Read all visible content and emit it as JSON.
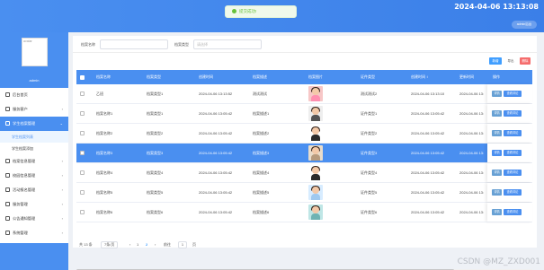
{
  "header": {
    "clock": "2024-04-06 13:13:08",
    "user_button": "admin后台",
    "toast": "提交成功!"
  },
  "sidebar": {
    "avatar_alt": "avatar",
    "admin_name": "admin",
    "items": [
      {
        "label": "后台首页",
        "icon": "home-icon"
      },
      {
        "label": "服务客户",
        "icon": "user-icon",
        "arrow": "›"
      },
      {
        "label": "学生档案管理",
        "icon": "folder-icon",
        "arrow": "⌄",
        "active": true
      },
      {
        "label": "学生档案列表",
        "sub": true,
        "current": true
      },
      {
        "label": "学生档案添加",
        "sub": true
      },
      {
        "label": "档案信息管理",
        "icon": "tag-icon",
        "arrow": "›"
      },
      {
        "label": "校园信息管理",
        "icon": "gear-icon",
        "arrow": "›"
      },
      {
        "label": "活动报名管理",
        "icon": "calendar-icon",
        "arrow": "›"
      },
      {
        "label": "服务管理",
        "icon": "box-icon",
        "arrow": "›"
      },
      {
        "label": "公告通知管理",
        "icon": "bell-icon",
        "arrow": "›"
      },
      {
        "label": "系统管理",
        "icon": "cog-icon",
        "arrow": "›"
      }
    ]
  },
  "search": {
    "label1": "档案名称",
    "input1": "",
    "label2": "档案类型",
    "select_placeholder": "请选择"
  },
  "actions": {
    "add": "新增",
    "export": "导出",
    "delete": "删除"
  },
  "table": {
    "headers": [
      "档案名称",
      "档案类型",
      "创建时间",
      "档案描述",
      "档案图片",
      "证件类型",
      "创建时间 ↕",
      "更新时间",
      "操作"
    ],
    "rows": [
      {
        "name": "乙班",
        "type": "档案类型1",
        "time": "2024-04-06 13:13:52",
        "desc": "测试测试",
        "thumb": "pink",
        "cert": "测试测试2",
        "created": "2024-04-06 13:13:10",
        "updated": "2024-04-06 13:",
        "sel": false
      },
      {
        "name": "档案名称1",
        "type": "档案类型1",
        "time": "2024-04-06 13:05:42",
        "desc": "档案描述1",
        "thumb": "gray",
        "cert": "证件类型1",
        "created": "2024-04-06 13:05:42",
        "updated": "2024-04-06 13:",
        "sel": false
      },
      {
        "name": "档案名称2",
        "type": "档案类型2",
        "time": "2024-04-06 13:05:42",
        "desc": "档案描述2",
        "thumb": "white",
        "cert": "证件类型2",
        "created": "2024-04-06 13:05:42",
        "updated": "2024-04-06 13:",
        "sel": false
      },
      {
        "name": "档案名称3",
        "type": "档案类型3",
        "time": "2024-04-06 13:05:42",
        "desc": "档案描述3",
        "thumb": "tan",
        "cert": "证件类型3",
        "created": "2024-04-06 13:05:42",
        "updated": "2024-04-06 13:",
        "sel": true
      },
      {
        "name": "档案名称4",
        "type": "档案类型4",
        "time": "2024-04-06 13:05:42",
        "desc": "档案描述4",
        "thumb": "white",
        "cert": "证件类型4",
        "created": "2024-04-06 13:05:42",
        "updated": "2024-04-06 13:",
        "sel": false
      },
      {
        "name": "档案名称5",
        "type": "档案类型5",
        "time": "2024-04-06 13:05:42",
        "desc": "档案描述5",
        "thumb": "sky",
        "cert": "证件类型5",
        "created": "2024-04-06 13:05:42",
        "updated": "2024-04-06 13:",
        "sel": false
      },
      {
        "name": "档案名称6",
        "type": "档案类型6",
        "time": "2024-04-06 13:05:42",
        "desc": "档案描述6",
        "thumb": "teal",
        "cert": "证件类型6",
        "created": "2024-04-06 13:05:42",
        "updated": "2024-04-06 13:",
        "sel": false
      }
    ],
    "detail_label": "详情",
    "edit_label": "查看评论"
  },
  "pagination": {
    "total": "共 13 条",
    "page_size": "7条/页",
    "prev": "‹",
    "pages": [
      "1",
      "2"
    ],
    "next": "›",
    "goto_label": "前往",
    "goto_value": "1",
    "goto_suffix": "页"
  },
  "watermark": "CSDN @MZ_ZXD001",
  "colors": {
    "primary": "#4a8ff0",
    "success": "#67c23a",
    "danger": "#f56c6c"
  }
}
